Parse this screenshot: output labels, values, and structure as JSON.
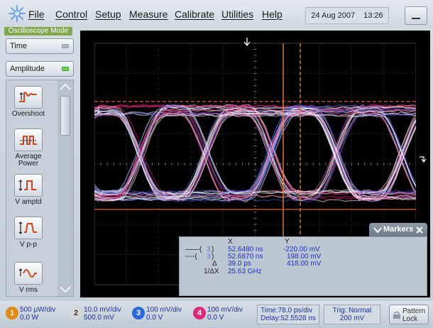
{
  "menu": {
    "file": "File",
    "control": "Control",
    "setup": "Setup",
    "measure": "Measure",
    "calibrate": "Calibrate",
    "utilities": "Utilities",
    "help": "Help"
  },
  "datetime": {
    "date": "24 Aug 2007",
    "time": "13:26"
  },
  "mode_label": "Oscilloscope Mode",
  "left_panel": {
    "time_dropdown": "Time",
    "amplitude_dropdown": "Amplitude",
    "measurements": [
      {
        "label": "Overshoot",
        "icon": "overshoot-icon"
      },
      {
        "label": "Average\nPower",
        "icon": "average-power-icon"
      },
      {
        "label": "V amptd",
        "icon": "v-amplitude-icon"
      },
      {
        "label": "V p-p",
        "icon": "v-peak-to-peak-icon"
      },
      {
        "label": "V rms",
        "icon": "v-rms-icon"
      }
    ]
  },
  "markers": {
    "tab_label": "Markers",
    "col_x": "X",
    "col_y": "Y",
    "m1_x": "52.6480 ns",
    "m1_y": "-220.00 mV",
    "m2_x": "52.6870 ns",
    "m2_y": "198.00 mV",
    "delta_label": "Δ",
    "delta_x": "39.0 ps",
    "delta_y": "418.00 mV",
    "inv_delta_label": "1/ΔX",
    "inv_delta_x": "25.63 GHz"
  },
  "channels": [
    {
      "num": "1",
      "line1": "500 µW/div",
      "line2": "0.0 W",
      "color": "#e08a1a"
    },
    {
      "num": "2",
      "line1": "10.0 mV/div",
      "line2": "500.0 mV",
      "color": "#d8d8d8"
    },
    {
      "num": "3",
      "line1": "100 mV/div",
      "line2": "0.0 V",
      "color": "#2a6ad8"
    },
    {
      "num": "4",
      "line1": "100 mV/div",
      "line2": "0.0 V",
      "color": "#e0287a"
    }
  ],
  "timebase": {
    "line1": "Time:78.0 ps/div",
    "line2": "Delay:52.5528 ns"
  },
  "trigger": {
    "line1": "Trig: Normal",
    "line2": "200 mV"
  },
  "pattern_lock": {
    "line1": "Pattern",
    "line2": "Lock"
  },
  "colors": {
    "marker_x": "#ff8a2a",
    "marker_y": "#e0602a",
    "trace_pink": "#e0287a",
    "trace_white": "#ffffff",
    "trace_blue": "#4a5ad8",
    "mode_label_bg": "#7ea84a"
  }
}
